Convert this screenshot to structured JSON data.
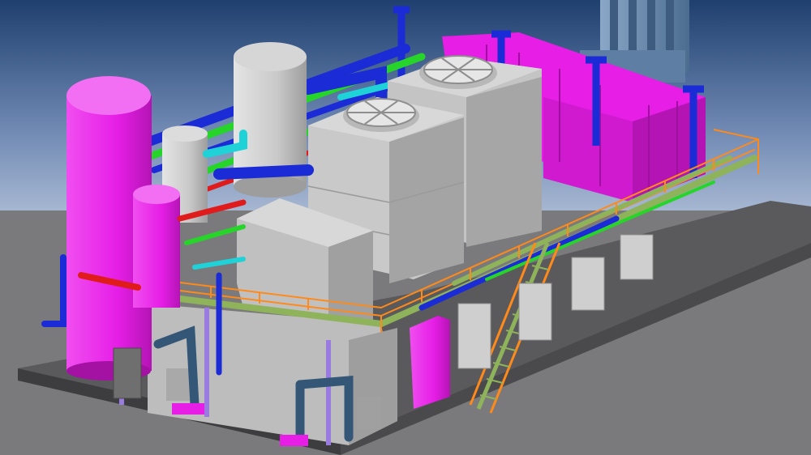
{
  "scene": {
    "kind": "3D CAD model render of a modular industrial process plant skid",
    "colors": {
      "sky_top": "#1f3f6e",
      "sky_bottom": "#9fb1cc",
      "ground": "#7a7a7c",
      "base_slab": "#4e4e50",
      "vessel_magenta": "#e61ee6",
      "equipment_grey": "#c9c9c9",
      "pipe_blue": "#1b2bd6",
      "pipe_green": "#27d42a",
      "pipe_red": "#e01b1b",
      "pipe_cyan": "#1fd2d8",
      "steel_green": "#8fb35a",
      "handrail_orange": "#ff8a1a",
      "structure_purple": "#9a7ce0",
      "duct_steel": "#355777"
    },
    "icons": [
      "fan-icon",
      "vessel-icon",
      "stair-icon",
      "duct-icon"
    ]
  }
}
